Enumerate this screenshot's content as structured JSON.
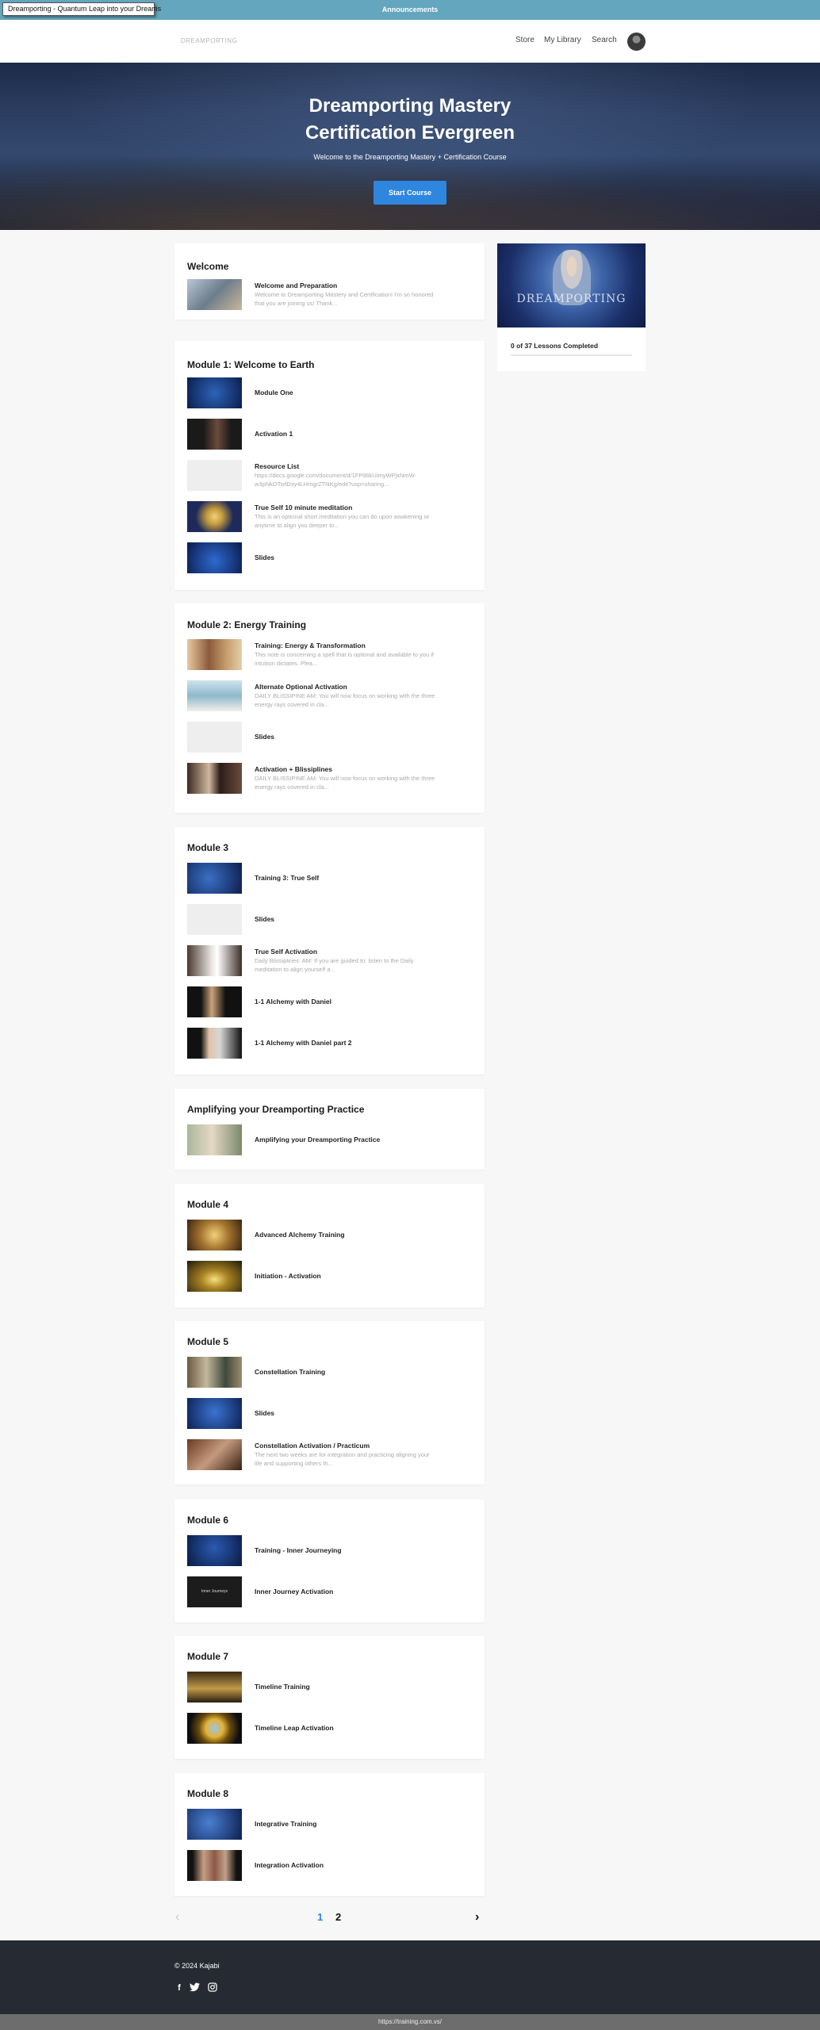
{
  "tooltip": "Dreamporting - Quantum Leap into your Dreams",
  "announcement": "Announcements",
  "header": {
    "logo": "DREAMPORTING",
    "nav": [
      "Store",
      "My Library",
      "Search"
    ]
  },
  "hero": {
    "title_line1": "Dreamporting Mastery",
    "title_line2": "Certification Evergreen",
    "subtitle": "Welcome to the Dreamporting Mastery + Certification Course",
    "button": "Start Course"
  },
  "sidebar": {
    "image_text": "DREAMPORTING",
    "progress_text": "0 of 37 Lessons Completed",
    "progress_fraction": 0
  },
  "modules": [
    {
      "title": "Welcome",
      "lessons": [
        {
          "title": "Welcome and Preparation",
          "desc": "Welcome to Dreamporting Mastery and Certification!  I'm so honored that you are joining us! Thank..."
        }
      ]
    },
    {
      "title": "Module 1: Welcome to Earth",
      "lessons": [
        {
          "title": "Module One",
          "desc": ""
        },
        {
          "title": "Activation 1",
          "desc": ""
        },
        {
          "title": "Resource List",
          "desc": "https://docs.google.com/document/d/1FP86kUimyWPjxNmW-w3pNkOTwfDxy4LHmgrZTNKg/edit?usp=sharing..."
        },
        {
          "title": "True Self 10 minute meditation",
          "desc": "This is an optional short meditation you can do upon awakening or anytime to align you deeper to..."
        },
        {
          "title": "Slides",
          "desc": ""
        }
      ]
    },
    {
      "title": "Module 2: Energy Training",
      "lessons": [
        {
          "title": "Training: Energy & Transformation",
          "desc": "This note is concerning a spell that is optional and available to you if intuition dictates. Plea..."
        },
        {
          "title": "Alternate Optional Activation",
          "desc": "DAILY BLISSIPINE   AM:   You will now focus on working with the three energy rays covered in cla..."
        },
        {
          "title": "Slides",
          "desc": ""
        },
        {
          "title": "Activation + Blissiplines",
          "desc": "DAILY BLISSIPINE   AM:   You will now focus on working with the three energy rays covered in cla..."
        }
      ]
    },
    {
      "title": "Module 3",
      "lessons": [
        {
          "title": "Training 3: True Self",
          "desc": ""
        },
        {
          "title": "Slides",
          "desc": ""
        },
        {
          "title": "True Self Activation",
          "desc": "Daily Blissiplines: AM:  If you are guided to: listen to the Daily meditation to align yourself a..."
        },
        {
          "title": "1-1 Alchemy with Daniel",
          "desc": ""
        },
        {
          "title": "1-1 Alchemy with Daniel part 2",
          "desc": ""
        }
      ]
    },
    {
      "title": "Amplifying your Dreamporting Practice",
      "lessons": [
        {
          "title": "Amplifying your Dreamporting Practice",
          "desc": ""
        }
      ]
    },
    {
      "title": "Module 4",
      "lessons": [
        {
          "title": "Advanced Alchemy Training",
          "desc": ""
        },
        {
          "title": "Initiation - Activation",
          "desc": ""
        }
      ]
    },
    {
      "title": "Module 5",
      "lessons": [
        {
          "title": "Constellation Training",
          "desc": ""
        },
        {
          "title": "Slides",
          "desc": ""
        },
        {
          "title": "Constellation Activation / Practicum",
          "desc": "The next two weeks are for integration and practicing aligning your life and supporting others th..."
        }
      ]
    },
    {
      "title": "Module 6",
      "lessons": [
        {
          "title": "Training - Inner Journeying",
          "desc": ""
        },
        {
          "title": "Inner Journey Activation",
          "desc": "",
          "thumb_text": "Inner Journeys"
        }
      ]
    },
    {
      "title": "Module 7",
      "lessons": [
        {
          "title": "Timeline Training",
          "desc": ""
        },
        {
          "title": "Timeline Leap Activation",
          "desc": ""
        }
      ]
    },
    {
      "title": "Module 8",
      "lessons": [
        {
          "title": "Integrative Training",
          "desc": ""
        },
        {
          "title": "Integration Activation",
          "desc": ""
        }
      ]
    }
  ],
  "pagination": {
    "prev": "‹",
    "next": "›",
    "pages": [
      "1",
      "2"
    ],
    "current": "1"
  },
  "footer": {
    "copyright": "© 2024 Kajabi",
    "social": [
      "facebook-icon",
      "twitter-icon",
      "instagram-icon"
    ]
  },
  "status_url": "https://training.com.vs/",
  "colors": {
    "accent": "#2e86de",
    "announcement_bg": "#64a6bd",
    "footer_bg": "#262a33"
  }
}
